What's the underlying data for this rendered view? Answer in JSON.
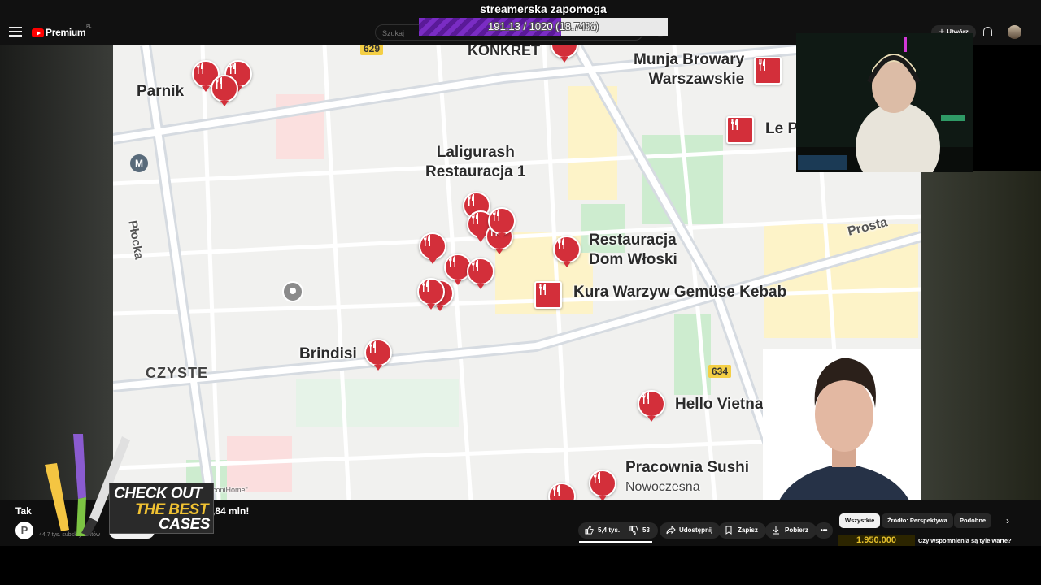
{
  "app": {
    "brand": "Premium",
    "region": "PL",
    "search_placeholder": "Szukaj",
    "create_label": "Utwórz"
  },
  "donation": {
    "title": "streamerska zapomoga",
    "progress_text": "191.13 / 1020 (18.74%)",
    "progress_fraction": 0.1874,
    "fill_color": "#7a2cc4"
  },
  "map": {
    "places": {
      "konkret": "KONKRET",
      "munja": "Munja Browary\nWarszawskie",
      "le_p": "Le P",
      "parnik": "Parnik",
      "laligurash": "Laligurash\nRestauracja 1",
      "dom_wloski": "Restauracja\nDom Włoski",
      "kura": "Kura Warzyw Gemüse Kebab",
      "brindisi": "Brindisi",
      "czyste": "CZYSTE",
      "hello_vietnam": "Hello Vietnam",
      "pracownia": "Pracownia Sushi",
      "nowoczesna": "Nowoczesna",
      "plocka": "Płocka",
      "prosta": "Prosta",
      "small_label": "…ąconiHome\""
    },
    "road_badges": [
      "629",
      "634"
    ],
    "metro_letter": "M",
    "pin_icon": "fork-knife-icon"
  },
  "video": {
    "title_start": "Tak",
    "title_end": ",84 mln!",
    "channel_initial": "P",
    "subscribers": "44,7 tys. subskrybentów"
  },
  "actions": {
    "likes": "5,4 tys.",
    "dislikes": "53",
    "share": "Udostępnij",
    "save": "Zapisz",
    "download": "Pobierz",
    "more": "•••"
  },
  "chips": [
    "Wszystkie",
    "Źródło: Perspektywa",
    "Podobne"
  ],
  "recommendation": {
    "thumb_text": "1.950.000",
    "title": "Czy wspomnienia są tyle warte?"
  },
  "ad": {
    "line1": "CHECK OUT",
    "line2": "THE BEST",
    "line3": "CASES"
  }
}
